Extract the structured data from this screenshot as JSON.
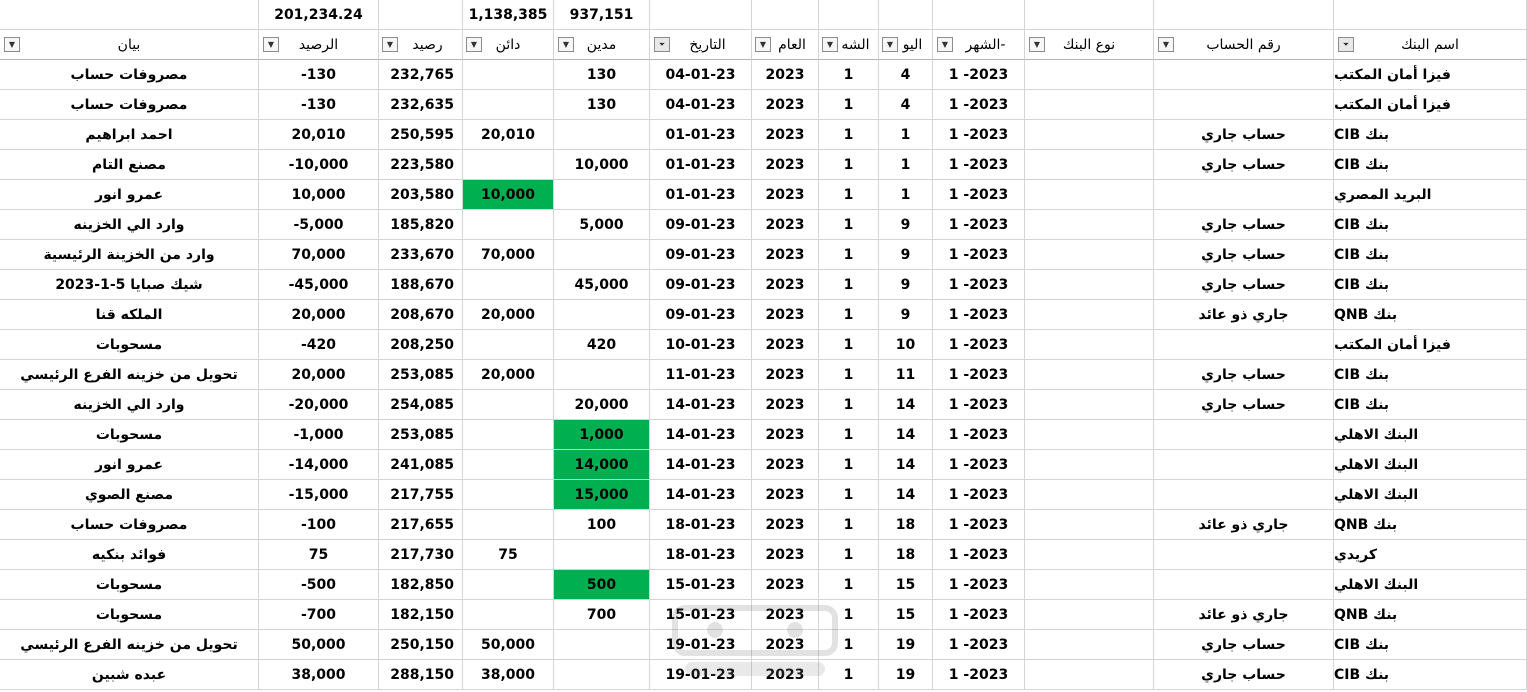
{
  "totals": {
    "balance_sum": "201,234.24",
    "credit_sum": "1,138,385",
    "debit_sum": "937,151"
  },
  "headers": {
    "statement": "بيان",
    "balance_col": "الرصيد",
    "running_balance": "رصيد",
    "credit": "دائن",
    "debit": "مدين",
    "date": "التاريخ",
    "year": "العام",
    "month_short": "الشه",
    "day_short": "اليو",
    "month_year": "الشهر-",
    "bank_type": "نوع البنك",
    "account_number": "رقم الحساب",
    "bank_name": "اسم البنك"
  },
  "filter_icon_names": [
    "filter-dropdown-icon",
    "filter-active-icon"
  ],
  "highlight_color": "#00b050",
  "rows": [
    {
      "statement": "مصروفات حساب",
      "balance": "-130",
      "running": "232,765",
      "credit": "",
      "debit": "130",
      "date": "04-01-23",
      "year": "2023",
      "month": "1",
      "day": "4",
      "month_year": "1 -2023",
      "bank_type": "",
      "account": "",
      "bank": "فيزا أمان المكتب",
      "credit_hl": false,
      "debit_hl": false
    },
    {
      "statement": "مصروفات حساب",
      "balance": "-130",
      "running": "232,635",
      "credit": "",
      "debit": "130",
      "date": "04-01-23",
      "year": "2023",
      "month": "1",
      "day": "4",
      "month_year": "1 -2023",
      "bank_type": "",
      "account": "",
      "bank": "فيزا أمان المكتب",
      "credit_hl": false,
      "debit_hl": false
    },
    {
      "statement": "احمد ابراهيم",
      "balance": "20,010",
      "running": "250,595",
      "credit": "20,010",
      "debit": "",
      "date": "01-01-23",
      "year": "2023",
      "month": "1",
      "day": "1",
      "month_year": "1 -2023",
      "bank_type": "",
      "account": "حساب جاري",
      "bank": "بنك CIB",
      "credit_hl": false,
      "debit_hl": false
    },
    {
      "statement": "مصنع التام",
      "balance": "-10,000",
      "running": "223,580",
      "credit": "",
      "debit": "10,000",
      "date": "01-01-23",
      "year": "2023",
      "month": "1",
      "day": "1",
      "month_year": "1 -2023",
      "bank_type": "",
      "account": "حساب جاري",
      "bank": "بنك CIB",
      "credit_hl": false,
      "debit_hl": false
    },
    {
      "statement": "عمرو انور",
      "balance": "10,000",
      "running": "203,580",
      "credit": "10,000",
      "debit": "",
      "date": "01-01-23",
      "year": "2023",
      "month": "1",
      "day": "1",
      "month_year": "1 -2023",
      "bank_type": "",
      "account": "",
      "bank": "البريد المصري",
      "credit_hl": true,
      "debit_hl": false
    },
    {
      "statement": "وارد الي الخزينه",
      "balance": "-5,000",
      "running": "185,820",
      "credit": "",
      "debit": "5,000",
      "date": "09-01-23",
      "year": "2023",
      "month": "1",
      "day": "9",
      "month_year": "1 -2023",
      "bank_type": "",
      "account": "حساب جاري",
      "bank": "بنك CIB",
      "credit_hl": false,
      "debit_hl": false
    },
    {
      "statement": "وارد من الخزينة الرئيسية",
      "balance": "70,000",
      "running": "233,670",
      "credit": "70,000",
      "debit": "",
      "date": "09-01-23",
      "year": "2023",
      "month": "1",
      "day": "9",
      "month_year": "1 -2023",
      "bank_type": "",
      "account": "حساب جاري",
      "bank": "بنك CIB",
      "credit_hl": false,
      "debit_hl": false
    },
    {
      "statement": "شيك صبايا 5-1-2023",
      "balance": "-45,000",
      "running": "188,670",
      "credit": "",
      "debit": "45,000",
      "date": "09-01-23",
      "year": "2023",
      "month": "1",
      "day": "9",
      "month_year": "1 -2023",
      "bank_type": "",
      "account": "حساب جاري",
      "bank": "بنك CIB",
      "credit_hl": false,
      "debit_hl": false
    },
    {
      "statement": "الملكه قنا",
      "balance": "20,000",
      "running": "208,670",
      "credit": "20,000",
      "debit": "",
      "date": "09-01-23",
      "year": "2023",
      "month": "1",
      "day": "9",
      "month_year": "1 -2023",
      "bank_type": "",
      "account": "جاري ذو عائد",
      "bank": "بنك QNB",
      "credit_hl": false,
      "debit_hl": false
    },
    {
      "statement": "مسحوبات",
      "balance": "-420",
      "running": "208,250",
      "credit": "",
      "debit": "420",
      "date": "10-01-23",
      "year": "2023",
      "month": "1",
      "day": "10",
      "month_year": "1 -2023",
      "bank_type": "",
      "account": "",
      "bank": "فيزا أمان المكتب",
      "credit_hl": false,
      "debit_hl": false
    },
    {
      "statement": "تحويل من خزينه الفرع الرئيسي",
      "balance": "20,000",
      "running": "253,085",
      "credit": "20,000",
      "debit": "",
      "date": "11-01-23",
      "year": "2023",
      "month": "1",
      "day": "11",
      "month_year": "1 -2023",
      "bank_type": "",
      "account": "حساب جاري",
      "bank": "بنك CIB",
      "credit_hl": false,
      "debit_hl": false
    },
    {
      "statement": "وارد الي الخزينه",
      "balance": "-20,000",
      "running": "254,085",
      "credit": "",
      "debit": "20,000",
      "date": "14-01-23",
      "year": "2023",
      "month": "1",
      "day": "14",
      "month_year": "1 -2023",
      "bank_type": "",
      "account": "حساب جاري",
      "bank": "بنك CIB",
      "credit_hl": false,
      "debit_hl": false
    },
    {
      "statement": "مسحوبات",
      "balance": "-1,000",
      "running": "253,085",
      "credit": "",
      "debit": "1,000",
      "date": "14-01-23",
      "year": "2023",
      "month": "1",
      "day": "14",
      "month_year": "1 -2023",
      "bank_type": "",
      "account": "",
      "bank": "البنك الاهلي",
      "credit_hl": false,
      "debit_hl": true
    },
    {
      "statement": "عمرو انور",
      "balance": "-14,000",
      "running": "241,085",
      "credit": "",
      "debit": "14,000",
      "date": "14-01-23",
      "year": "2023",
      "month": "1",
      "day": "14",
      "month_year": "1 -2023",
      "bank_type": "",
      "account": "",
      "bank": "البنك الاهلي",
      "credit_hl": false,
      "debit_hl": true
    },
    {
      "statement": "مصنع الصوي",
      "balance": "-15,000",
      "running": "217,755",
      "credit": "",
      "debit": "15,000",
      "date": "14-01-23",
      "year": "2023",
      "month": "1",
      "day": "14",
      "month_year": "1 -2023",
      "bank_type": "",
      "account": "",
      "bank": "البنك الاهلي",
      "credit_hl": false,
      "debit_hl": true
    },
    {
      "statement": "مصروفات حساب",
      "balance": "-100",
      "running": "217,655",
      "credit": "",
      "debit": "100",
      "date": "18-01-23",
      "year": "2023",
      "month": "1",
      "day": "18",
      "month_year": "1 -2023",
      "bank_type": "",
      "account": "جاري ذو عائد",
      "bank": "بنك QNB",
      "credit_hl": false,
      "debit_hl": false
    },
    {
      "statement": "فوائد بنكيه",
      "balance": "75",
      "running": "217,730",
      "credit": "75",
      "debit": "",
      "date": "18-01-23",
      "year": "2023",
      "month": "1",
      "day": "18",
      "month_year": "1 -2023",
      "bank_type": "",
      "account": "",
      "bank": "كريدي",
      "credit_hl": false,
      "debit_hl": false
    },
    {
      "statement": "مسحوبات",
      "balance": "-500",
      "running": "182,850",
      "credit": "",
      "debit": "500",
      "date": "15-01-23",
      "year": "2023",
      "month": "1",
      "day": "15",
      "month_year": "1 -2023",
      "bank_type": "",
      "account": "",
      "bank": "البنك الاهلي",
      "credit_hl": false,
      "debit_hl": true
    },
    {
      "statement": "مسحوبات",
      "balance": "-700",
      "running": "182,150",
      "credit": "",
      "debit": "700",
      "date": "15-01-23",
      "year": "2023",
      "month": "1",
      "day": "15",
      "month_year": "1 -2023",
      "bank_type": "",
      "account": "جاري ذو عائد",
      "bank": "بنك QNB",
      "credit_hl": false,
      "debit_hl": false
    },
    {
      "statement": "تحويل من خزينه الفرع الرئيسي",
      "balance": "50,000",
      "running": "250,150",
      "credit": "50,000",
      "debit": "",
      "date": "19-01-23",
      "year": "2023",
      "month": "1",
      "day": "19",
      "month_year": "1 -2023",
      "bank_type": "",
      "account": "حساب جاري",
      "bank": "بنك CIB",
      "credit_hl": false,
      "debit_hl": false
    },
    {
      "statement": "عبده شبين",
      "balance": "38,000",
      "running": "288,150",
      "credit": "38,000",
      "debit": "",
      "date": "19-01-23",
      "year": "2023",
      "month": "1",
      "day": "19",
      "month_year": "1 -2023",
      "bank_type": "",
      "account": "حساب جاري",
      "bank": "بنك CIB",
      "credit_hl": false,
      "debit_hl": false
    }
  ]
}
